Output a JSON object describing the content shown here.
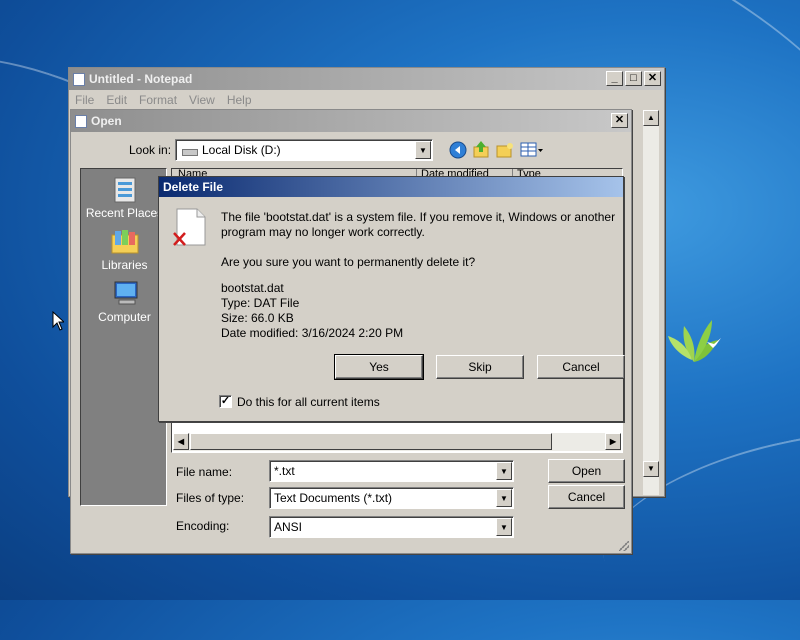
{
  "notepad": {
    "title": "Untitled - Notepad",
    "menu": [
      "File",
      "Edit",
      "Format",
      "View",
      "Help"
    ]
  },
  "open_dialog": {
    "title": "Open",
    "look_in_label": "Look in:",
    "look_in_value": "Local Disk (D:)",
    "columns": [
      "Name",
      "Date modified",
      "Type"
    ],
    "places": [
      "Recent Places",
      "Libraries",
      "Computer"
    ],
    "file_name_label": "File name:",
    "file_name_value": "*.txt",
    "files_of_type_label": "Files of type:",
    "files_of_type_value": "Text Documents (*.txt)",
    "encoding_label": "Encoding:",
    "encoding_value": "ANSI",
    "open_button": "Open",
    "cancel_button": "Cancel"
  },
  "delete_dialog": {
    "title": "Delete File",
    "message_line1": "The file 'bootstat.dat' is a system file. If you remove it, Windows or another",
    "message_line2": "program may no longer work correctly.",
    "question": "Are you sure you want to permanently delete it?",
    "file_name": "bootstat.dat",
    "file_type": "Type: DAT File",
    "file_size": "Size: 66.0 KB",
    "file_modified": "Date modified: 3/16/2024 2:20 PM",
    "yes_button": "Yes",
    "skip_button": "Skip",
    "cancel_button": "Cancel",
    "checkbox_label": "Do this for all current items",
    "checkbox_checked": true
  },
  "colors": {
    "active_title": "#0a2a70",
    "dialog_face": "#d4d0c8",
    "places_bar": "#808080"
  }
}
